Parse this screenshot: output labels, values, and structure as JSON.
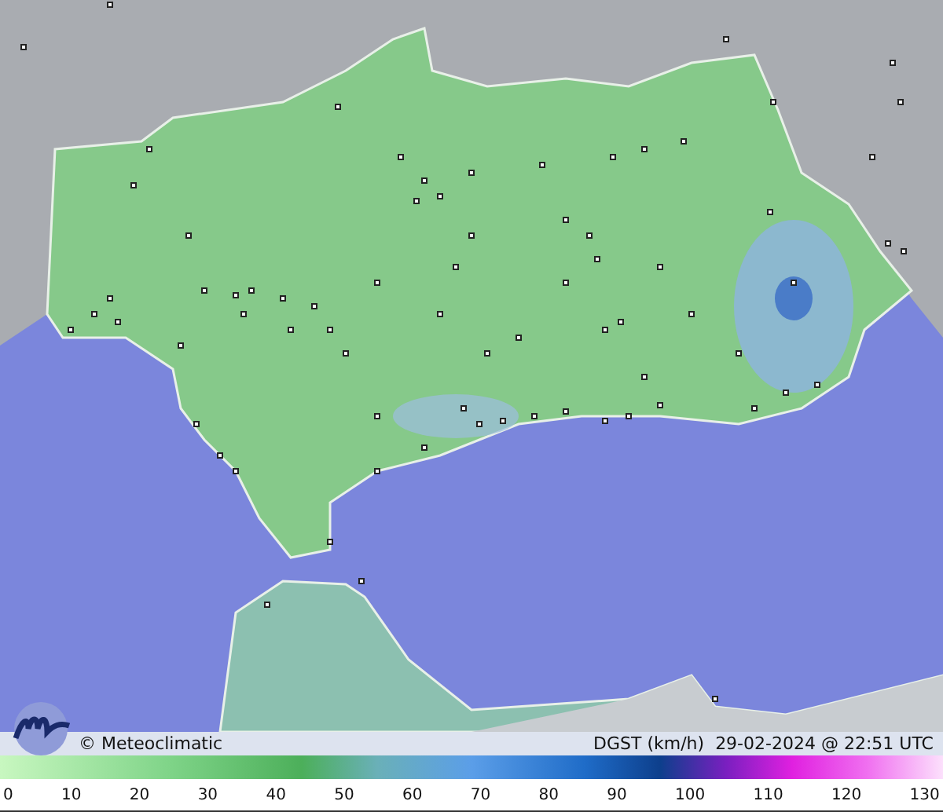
{
  "caption": {
    "copyright": "© Meteoclimatic",
    "variable": "DGST (km/h)  29-02-2024 @ 22:51 UTC"
  },
  "legend": {
    "ticks": [
      "0",
      "10",
      "20",
      "30",
      "40",
      "50",
      "60",
      "70",
      "80",
      "90",
      "100",
      "110",
      "120",
      "130"
    ]
  }
}
